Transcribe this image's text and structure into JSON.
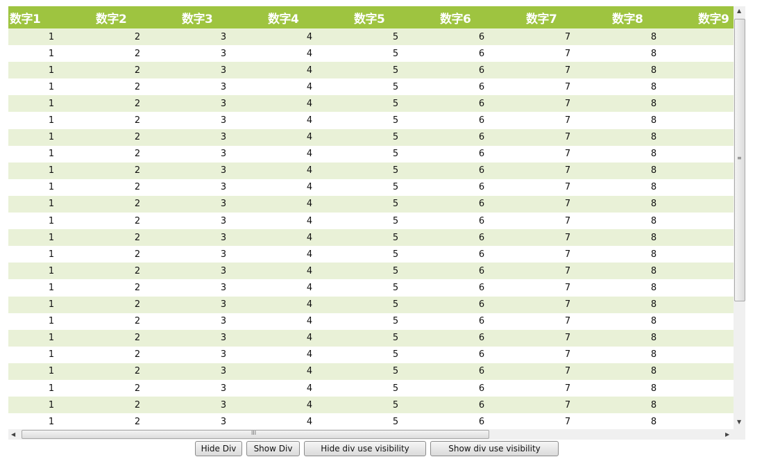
{
  "table": {
    "headers": [
      "数字1",
      "数字2",
      "数字3",
      "数字4",
      "数字5",
      "数字6",
      "数字7",
      "数字8",
      "数字9"
    ],
    "rows": [
      [
        1,
        2,
        3,
        4,
        5,
        6,
        7,
        8
      ],
      [
        1,
        2,
        3,
        4,
        5,
        6,
        7,
        8
      ],
      [
        1,
        2,
        3,
        4,
        5,
        6,
        7,
        8
      ],
      [
        1,
        2,
        3,
        4,
        5,
        6,
        7,
        8
      ],
      [
        1,
        2,
        3,
        4,
        5,
        6,
        7,
        8
      ],
      [
        1,
        2,
        3,
        4,
        5,
        6,
        7,
        8
      ],
      [
        1,
        2,
        3,
        4,
        5,
        6,
        7,
        8
      ],
      [
        1,
        2,
        3,
        4,
        5,
        6,
        7,
        8
      ],
      [
        1,
        2,
        3,
        4,
        5,
        6,
        7,
        8
      ],
      [
        1,
        2,
        3,
        4,
        5,
        6,
        7,
        8
      ],
      [
        1,
        2,
        3,
        4,
        5,
        6,
        7,
        8
      ],
      [
        1,
        2,
        3,
        4,
        5,
        6,
        7,
        8
      ],
      [
        1,
        2,
        3,
        4,
        5,
        6,
        7,
        8
      ],
      [
        1,
        2,
        3,
        4,
        5,
        6,
        7,
        8
      ],
      [
        1,
        2,
        3,
        4,
        5,
        6,
        7,
        8
      ],
      [
        1,
        2,
        3,
        4,
        5,
        6,
        7,
        8
      ],
      [
        1,
        2,
        3,
        4,
        5,
        6,
        7,
        8
      ],
      [
        1,
        2,
        3,
        4,
        5,
        6,
        7,
        8
      ],
      [
        1,
        2,
        3,
        4,
        5,
        6,
        7,
        8
      ],
      [
        1,
        2,
        3,
        4,
        5,
        6,
        7,
        8
      ],
      [
        1,
        2,
        3,
        4,
        5,
        6,
        7,
        8
      ],
      [
        1,
        2,
        3,
        4,
        5,
        6,
        7,
        8
      ],
      [
        1,
        2,
        3,
        4,
        5,
        6,
        7,
        8
      ],
      [
        1,
        2,
        3,
        4,
        5,
        6,
        7,
        8
      ]
    ]
  },
  "colors": {
    "header_bg": "#9ec440",
    "row_alt_bg": "#e9f1d7"
  },
  "buttons": {
    "hide_div": "Hide Div",
    "show_div": "Show Div",
    "hide_visibility": "Hide div use visibility",
    "show_visibility": "Show div use visibility"
  }
}
